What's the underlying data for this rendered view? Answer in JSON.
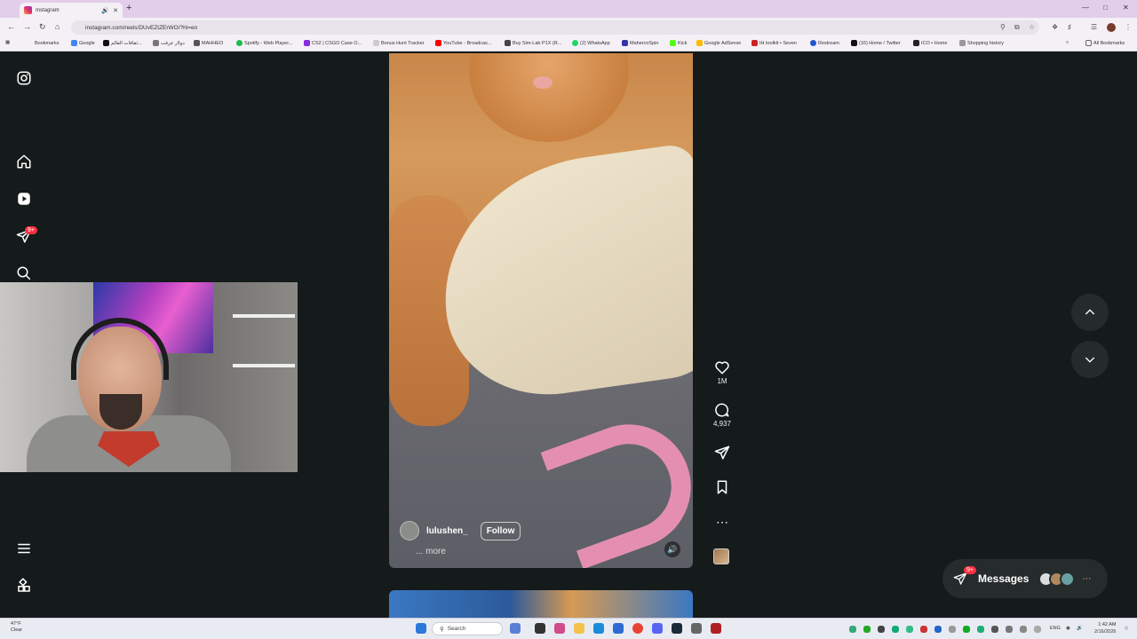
{
  "browser": {
    "tab_title": "Instagram",
    "url": "instagram.com/reels/DUvEZtZErWO/?hl=en",
    "bookmarks": [
      {
        "label": "Bookmarks",
        "color": "#333333"
      },
      {
        "label": "Google",
        "color": "#4285f4"
      },
      {
        "label": "ثقافات العالم...",
        "color": "#111111"
      },
      {
        "label": "دولار عرفت",
        "color": "#777777"
      },
      {
        "label": "MAHHEO",
        "color": "#555555"
      },
      {
        "label": "Spotify - Web Player...",
        "color": "#1db954"
      },
      {
        "label": "CS2 | CSGO Case O...",
        "color": "#8a2be2"
      },
      {
        "label": "Bonus Hunt Tracker",
        "color": "#cccccc"
      },
      {
        "label": "YouTube - Broadcas...",
        "color": "#ff0000"
      },
      {
        "label": "Buy Sim-Lab P1X (R...",
        "color": "#444444"
      },
      {
        "label": "(2) WhatsApp",
        "color": "#25d366"
      },
      {
        "label": "MahercoSpin",
        "color": "#3333aa"
      },
      {
        "label": "Kick",
        "color": "#53fc18"
      },
      {
        "label": "Google AdSense",
        "color": "#fbbc05"
      },
      {
        "label": "IH toolkit • Seven",
        "color": "#cc2222"
      },
      {
        "label": "Restream",
        "color": "#2255cc"
      },
      {
        "label": "(16) Home / Twitter",
        "color": "#111111"
      },
      {
        "label": "ICO • Home",
        "color": "#222222"
      },
      {
        "label": "Shopping history",
        "color": "#999999"
      }
    ],
    "all_bookmarks_label": "All Bookmarks"
  },
  "sidebar": {
    "notification_badge": "9+"
  },
  "reel": {
    "username": "lulushen_",
    "follow_label": "Follow",
    "more_label": "... more",
    "likes": "1M",
    "comments": "4,937"
  },
  "messages": {
    "label": "Messages",
    "badge": "9+"
  },
  "taskbar": {
    "temperature": "47°F",
    "condition": "Clear",
    "search_placeholder": "Search",
    "language": "ENG",
    "time": "1:42 AM",
    "date": "2/16/2026"
  }
}
